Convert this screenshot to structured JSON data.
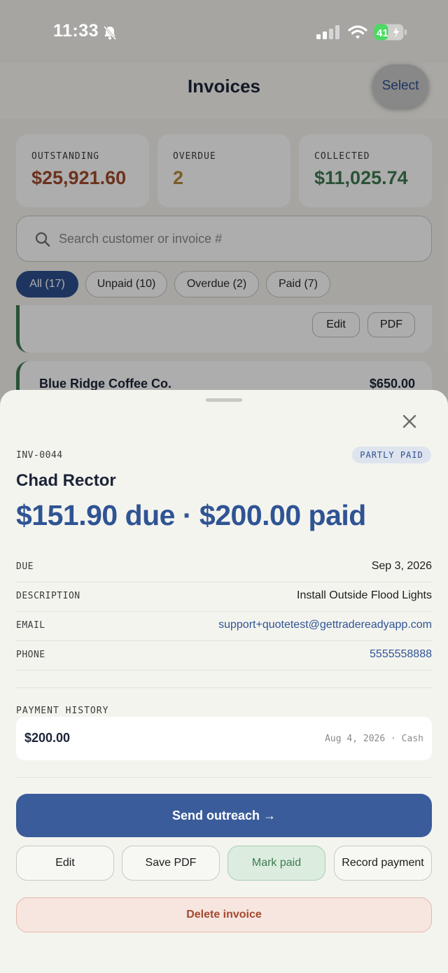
{
  "status_bar": {
    "time": "11:33",
    "battery": "41"
  },
  "nav": {
    "title": "Invoices",
    "select_label": "Select"
  },
  "stats": [
    {
      "label": "OUTSTANDING",
      "value": "$25,921.60",
      "color": "#a04a2c"
    },
    {
      "label": "OVERDUE",
      "value": "2",
      "color": "#b88a3c"
    },
    {
      "label": "COLLECTED",
      "value": "$11,025.74",
      "color": "#3e7a52"
    }
  ],
  "search": {
    "placeholder": "Search customer or invoice #"
  },
  "filters": [
    {
      "label": "All (17)",
      "active": true
    },
    {
      "label": "Unpaid (10)",
      "active": false
    },
    {
      "label": "Overdue (2)",
      "active": false
    },
    {
      "label": "Paid (7)",
      "active": false
    }
  ],
  "list": {
    "card1": {
      "edit_label": "Edit",
      "pdf_label": "PDF"
    },
    "card2": {
      "name": "Blue Ridge Coffee Co.",
      "amount": "$650.00"
    }
  },
  "sheet": {
    "invoice_id": "INV-0044",
    "status_badge": "PARTLY PAID",
    "customer": "Chad Rector",
    "amount_line": "$151.90 due · $200.00 paid",
    "details": [
      {
        "label": "DUE",
        "value": "Sep 3, 2026",
        "link": false
      },
      {
        "label": "DESCRIPTION",
        "value": "Install Outside Flood Lights",
        "link": false
      },
      {
        "label": "EMAIL",
        "value": "support+quotetest@gettradereadyapp.com",
        "link": true
      },
      {
        "label": "PHONE",
        "value": "5555558888",
        "link": true
      }
    ],
    "payment_history": {
      "label": "PAYMENT HISTORY",
      "entries": [
        {
          "amount": "$200.00",
          "meta": "Aug 4, 2026 · Cash"
        }
      ]
    },
    "actions": {
      "send_outreach": "Send outreach →",
      "edit": "Edit",
      "save_pdf": "Save PDF",
      "mark_paid": "Mark paid",
      "record_payment": "Record payment",
      "delete": "Delete invoice"
    }
  },
  "colors": {
    "accent": "#2d4f8e",
    "paid_green": "#3e7a52",
    "danger": "#a4482e"
  }
}
